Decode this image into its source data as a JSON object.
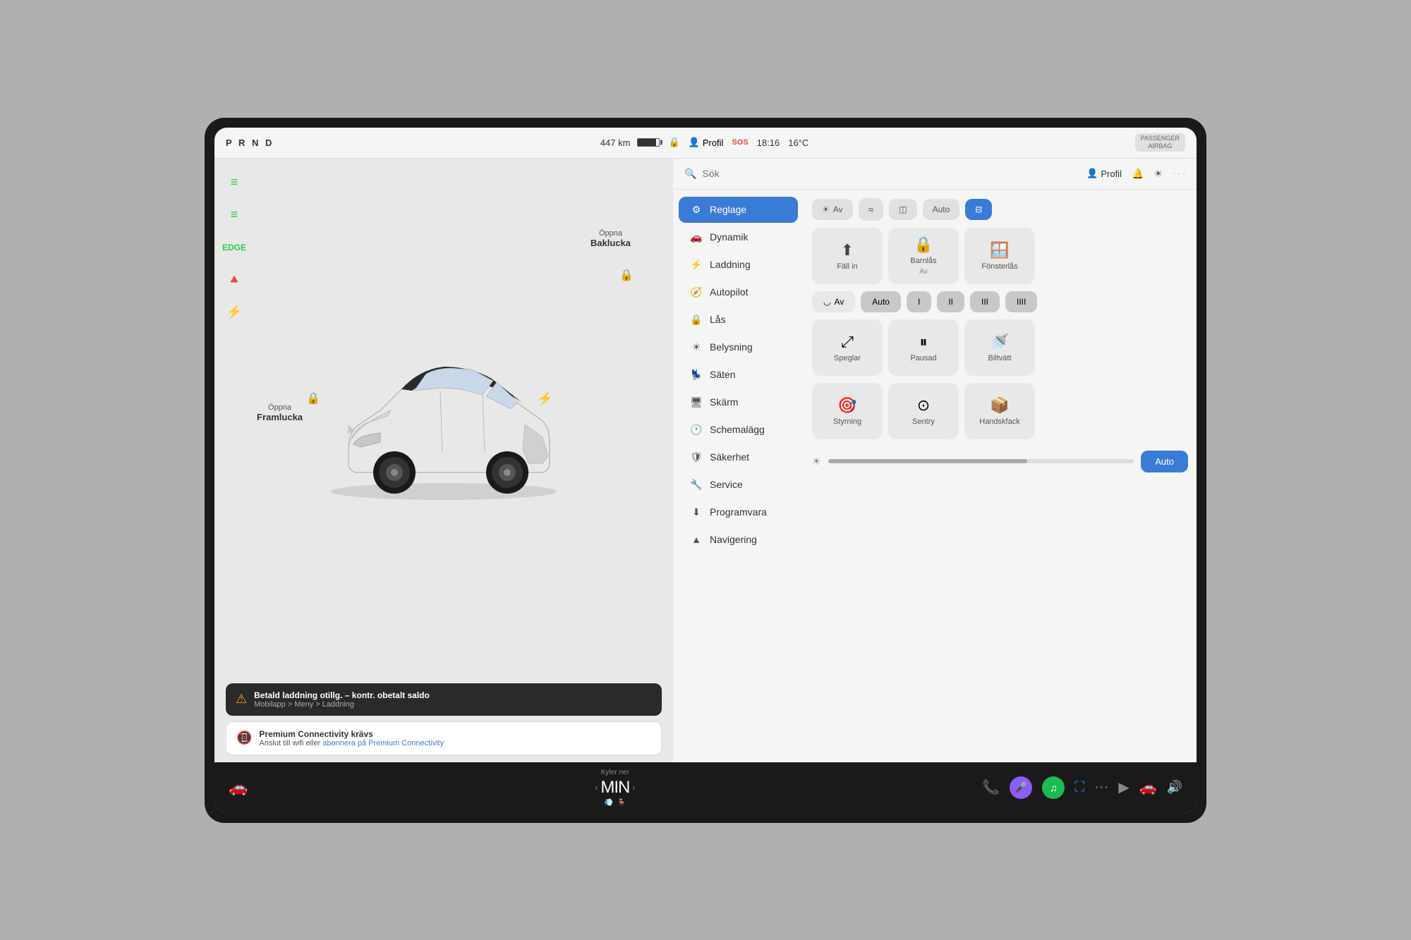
{
  "screen": {
    "prnd": "P R N D",
    "range": "447 km",
    "time": "18:16",
    "temp": "16°C",
    "profile": "Profil",
    "airbag_label1": "PASSENGER",
    "airbag_label2": "AIRBAG",
    "search_placeholder": "Sök"
  },
  "search_bar": {
    "profile_label": "Profil"
  },
  "left_panel": {
    "door_front_label": "Öppna",
    "door_front_action": "Framlucka",
    "door_rear_label": "Öppna",
    "door_rear_action": "Baklucka",
    "alert_title": "Betald laddning otillg. – kontr. obetalt saldo",
    "alert_sub": "Mobilapp > Meny > Laddning",
    "info_title": "Premium Connectivity krävs",
    "info_sub_pre": "Anslut till wifi eller ",
    "info_link": "abonnera på Premium Connectivity"
  },
  "menu": {
    "items": [
      {
        "id": "reglage",
        "label": "Reglage",
        "icon": "⚙",
        "active": true
      },
      {
        "id": "dynamik",
        "label": "Dynamik",
        "icon": "🚗",
        "active": false
      },
      {
        "id": "laddning",
        "label": "Laddning",
        "icon": "⚡",
        "active": false
      },
      {
        "id": "autopilot",
        "label": "Autopilot",
        "icon": "🧭",
        "active": false
      },
      {
        "id": "las",
        "label": "Lås",
        "icon": "🔒",
        "active": false
      },
      {
        "id": "belysning",
        "label": "Belysning",
        "icon": "☀",
        "active": false
      },
      {
        "id": "saten",
        "label": "Säten",
        "icon": "💺",
        "active": false
      },
      {
        "id": "skarm",
        "label": "Skärm",
        "icon": "🖥",
        "active": false
      },
      {
        "id": "schemalaggg",
        "label": "Schemalägg",
        "icon": "🕐",
        "active": false
      },
      {
        "id": "sakerhet",
        "label": "Säkerhet",
        "icon": "🛡",
        "active": false
      },
      {
        "id": "service",
        "label": "Service",
        "icon": "🔧",
        "active": false
      },
      {
        "id": "programvara",
        "label": "Programvara",
        "icon": "⬇",
        "active": false
      },
      {
        "id": "navigering",
        "label": "Navigering",
        "icon": "▲",
        "active": false
      }
    ]
  },
  "settings": {
    "light_buttons": [
      {
        "label": "Av",
        "icon": "☀",
        "active": false
      },
      {
        "label": "",
        "icon": "≈",
        "active": false
      },
      {
        "label": "",
        "icon": "◫",
        "active": false
      },
      {
        "label": "Auto",
        "icon": "",
        "active": false
      },
      {
        "label": "",
        "icon": "⊟",
        "active": true,
        "blue": true
      }
    ],
    "lock_tiles": [
      {
        "label": "Fäll in",
        "icon": "⬆",
        "sub": ""
      },
      {
        "label": "Barnlås",
        "icon": "🔒",
        "sub": "Av"
      },
      {
        "label": "Fönsterlås",
        "icon": "🪟",
        "sub": ""
      }
    ],
    "wiper_buttons": [
      {
        "label": "Av",
        "icon": "◡",
        "active": true
      },
      {
        "label": "Auto",
        "icon": "",
        "active": false
      },
      {
        "label": "I",
        "active": false
      },
      {
        "label": "II",
        "active": false
      },
      {
        "label": "III",
        "active": false
      },
      {
        "label": "IIII",
        "active": false
      }
    ],
    "mirror_tiles": [
      {
        "label": "Speglar",
        "icon": "⤢"
      },
      {
        "label": "Pausad",
        "icon": "⏸"
      },
      {
        "label": "Biltvätt",
        "icon": "🚗"
      }
    ],
    "steering_tiles": [
      {
        "label": "Styrning",
        "icon": "🎯"
      },
      {
        "label": "Sentry",
        "icon": "⊙"
      },
      {
        "label": "Handskfack",
        "icon": "🖥"
      }
    ],
    "brightness_label": "Auto"
  },
  "bottom_bar": {
    "temp_label": "Kyler ner",
    "temp_value": "MIN",
    "climate_icons": [
      "📞",
      "🎵",
      "*",
      "···",
      "▶",
      "🚗"
    ]
  }
}
